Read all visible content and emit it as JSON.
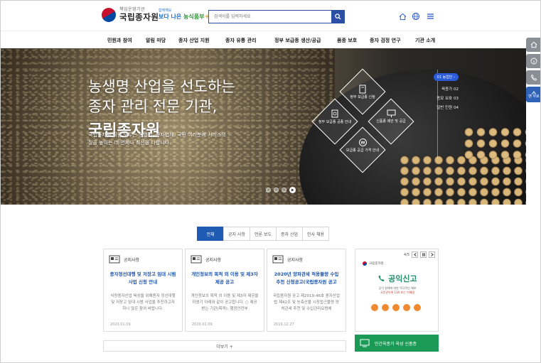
{
  "header": {
    "logo_sub": "책임운영기관",
    "logo_main": "국립종자원",
    "slogan_top": "함께해요",
    "slogan_word1": "보다 나은",
    "slogan_word2": "농식품부",
    "search_placeholder": "검색어를 입력하세요"
  },
  "gnb": [
    "민원과 참여",
    "알림 마당",
    "종자 산업 지원",
    "종자 유통 관리",
    "정부 보급종 생산/공급",
    "품종 보호",
    "종자 검정 연구",
    "기관 소개"
  ],
  "hero": {
    "title_line1": "농생명 산업을 선도하는",
    "title_line2": "종자 관리 전문 기관,",
    "title_strong": "국립종자원",
    "desc": "국립종자원 직원 모두는 농업인, 종자업체, 국민 여러분께 서비스의 질을 높이는 데 언제나 최선을 다합니다.",
    "services": [
      "정부 보급종 신청",
      "정부 보급종 공종 안내",
      "신품종 제안 및 공급",
      "보급종 공급 가격 안내"
    ],
    "list_first": "01 농업인 ›",
    "list_items": [
      "육종가 02",
      "종묘 보호 03",
      "일반 민원 04"
    ]
  },
  "quick_menu": {
    "top_label": "맨 위로"
  },
  "tabs": [
    {
      "label": "전체",
      "active": true
    },
    {
      "label": "공지 사항",
      "active": false
    },
    {
      "label": "언론 보도",
      "active": false
    },
    {
      "label": "종자 산업",
      "active": false
    },
    {
      "label": "인사 채용",
      "active": false
    }
  ],
  "cards": [
    {
      "category": "공지사항",
      "title": "종자정선대행 및 저장고 임대 시범사업 신청 안내",
      "body": "식량종자산업 육성을 위해종자 정선대행 및 저장고 임대 시범 사업을 추진하고자 하니 많은 참여 바랍니다.",
      "date": "2020.01.09"
    },
    {
      "category": "공지사항",
      "title": "개인정보의 목적 외 이용 및 제3자 제공 공고",
      "body": "개인정보의 목적 외 이용 및 제3자 제공을 하였기 아래와 같이 공고합니다. ○ 제공받는 기관(목적): 행정안전부",
      "date": "2020.01.09"
    },
    {
      "category": "공지사항",
      "title": "2020년 양파관세 적용물량 수입 추천 신청공고(국립종자원 공고",
      "body": "국립종자원 공고 제2019-46호 종자산업법 제42조 및 농축산물 시장접근물량 양허관세 추천 및 수입관리요령에",
      "date": "2019.12.27"
    }
  ],
  "more_label": "더보기 +",
  "banner": {
    "counter": "4/5",
    "org": "국립종자원",
    "title": "공익신고",
    "sub_line1": "공익 침해에 대한 적극적인 제보",
    "sub_line2": "국민권익위 110 또는 이메일"
  },
  "green_banner": "민간육종가 육성 신품종",
  "colors": {
    "primary": "#1f5bb3",
    "green": "#1b9a55",
    "orange": "#ef8a33"
  }
}
